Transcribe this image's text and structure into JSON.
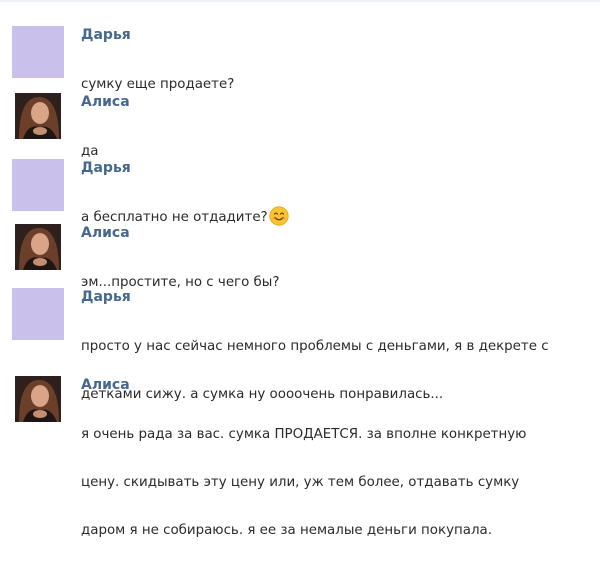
{
  "messages": [
    {
      "author": "Дарья",
      "avatar": "blank-avatar",
      "lines": [
        "сумку еще продаете?"
      ]
    },
    {
      "author": "Алиса",
      "avatar": "photo-avatar",
      "lines": [
        "да"
      ]
    },
    {
      "author": "Дарья",
      "avatar": "blank-avatar",
      "lines": [
        "а бесплатно не отдадите?"
      ],
      "emoji": "smiley-emoji"
    },
    {
      "author": "Алиса",
      "avatar": "photo-avatar",
      "lines": [
        "эм...простите, но с чего бы?"
      ]
    },
    {
      "author": "Дарья",
      "avatar": "blank-avatar",
      "lines": [
        "просто у нас сейчас немного проблемы с деньгами, я в декрете с",
        "детками сижу. а сумка ну оооочень понравилась..."
      ]
    },
    {
      "author": "Алиса",
      "avatar": "photo-avatar",
      "lines": [
        "я очень рада за вас. сумка ПРОДАЕТСЯ. за вполне конкретную",
        "цену. скидывать эту цену или, уж тем более, отдавать сумку",
        "даром я не собираюсь. я ее за немалые деньги покупала."
      ]
    }
  ],
  "colors": {
    "author": "#45688e",
    "blank_avatar": "#cac0ec",
    "text": "#2a2a2a"
  }
}
